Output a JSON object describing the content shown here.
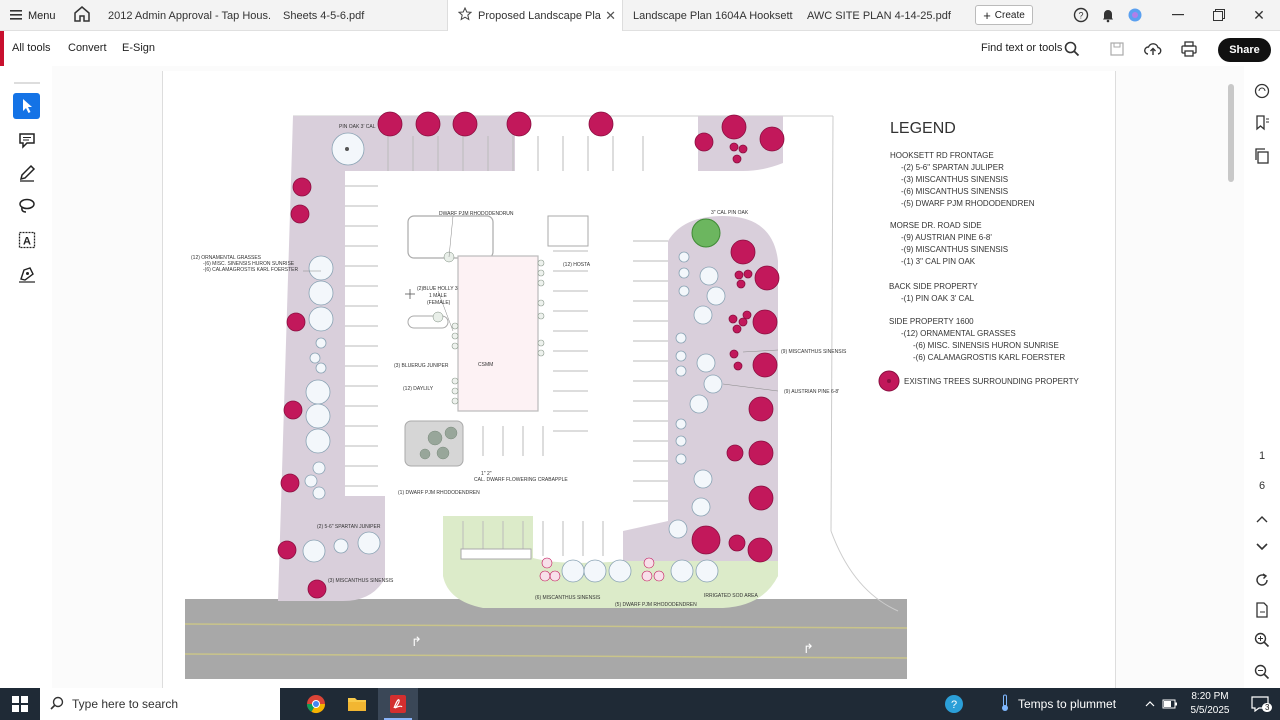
{
  "tabbar": {
    "menu_label": "Menu",
    "tabs": [
      {
        "label": "2012 Admin Approval - Tap Hous..."
      },
      {
        "label": "Sheets 4-5-6.pdf"
      },
      {
        "label": "Proposed Landscape Pla",
        "active": true
      },
      {
        "label": "Landscape Plan 1604A Hooksett ..."
      },
      {
        "label": "AWC SITE PLAN 4-14-25.pdf"
      }
    ],
    "create_label": "Create"
  },
  "toolbar": {
    "all_tools": "All tools",
    "convert": "Convert",
    "esign": "E-Sign",
    "find_text": "Find text or tools",
    "share": "Share"
  },
  "right_rail": {
    "page_current": "1",
    "page_total": "6"
  },
  "plan": {
    "legend_title": "LEGEND",
    "legend_groups": [
      {
        "heading": "HOOKSETT RD FRONTAGE",
        "items": [
          "-(2) 5-6\" SPARTAN JULIPER",
          "-(3) MISCANTHUS SINENSIS",
          "-(6) MISCANTHUS SINENSIS",
          "-(5) DWARF PJM RHODODENDREN"
        ]
      },
      {
        "heading": "MORSE DR. ROAD SIDE",
        "items": [
          "-(9) AUSTRIAN PINE 6-8'",
          "-(9) MISCANTHUS SINENSIS",
          "-(1) 3\" CAL PIN OAK"
        ]
      },
      {
        "heading": "BACK SIDE PROPERTY",
        "items": [
          "-(1) PIN OAK 3' CAL"
        ]
      },
      {
        "heading": "SIDE PROPERTY 1600",
        "items": [
          "-(12) ORNAMENTAL GRASSES",
          "-(6) MISC. SINENSIS HURON SUNRISE",
          "-(6) CALAMAGROSTIS KARL FOERSTER"
        ]
      }
    ],
    "existing_trees_label": "EXISTING TREES SURROUNDING PROPERTY",
    "labels": {
      "pin_oak_top": "PIN OAK 3' CAL",
      "dwarf_pjm_top": "DWARF PJM RHODODENDRUN",
      "pin_oak_right": "3\" CAL PIN OAK",
      "ornamental_1": "(12) ORNAMENTAL GRASSES",
      "ornamental_2": "-(6) MISC. SINENSIS HURON SUNRISE",
      "ornamental_3": "-(6) CALAMAGROSTIS KARL FOERSTER",
      "hosta": "(12) HOSTA",
      "blue_holly_1": "(2)BLUE HOLLY 3",
      "blue_holly_2": "1 MALE",
      "blue_holly_3": "(FEMALE)",
      "bluerug": "(3) BLUERUG JUNIPER",
      "daylily": "(12) DAYLILY",
      "misc_right": "(9) MISCANTHUS SINENSIS",
      "austrian_right": "(9) AUSTRIAN PINE 6-8'",
      "crabapple_1": "1\" 2\"",
      "crabapple_2": "CAL. DWARF FLOWERING CRABAPPLE",
      "dwarf_pjm_mid": "(1) DWARF PJM RHODODENDREN",
      "spartan": "(2) 5-6\" SPARTAN JUNIPER",
      "misc_left": "(3) MISCANTHUS SINENSIS",
      "misc_bottom": "(6) MISCANTHUS SINENSIS",
      "dwarf_pjm_bottom": "(5) DWARF PJM RHODODENDREN",
      "irrigated_sod": "IRRIGATED SOD AREA",
      "center_label": "CSMM"
    }
  },
  "taskbar": {
    "search_placeholder": "Type here to search",
    "weather": "Temps to plummet",
    "time": "8:20 PM",
    "date": "5/5/2025",
    "notification_count": "3"
  },
  "colors": {
    "existing_tree": "#c2185b",
    "planting_bed": "#d9cfdb",
    "sod_area": "#dcebc9",
    "accent_blue": "#1473e6",
    "taskbar": "#1f2a36"
  }
}
